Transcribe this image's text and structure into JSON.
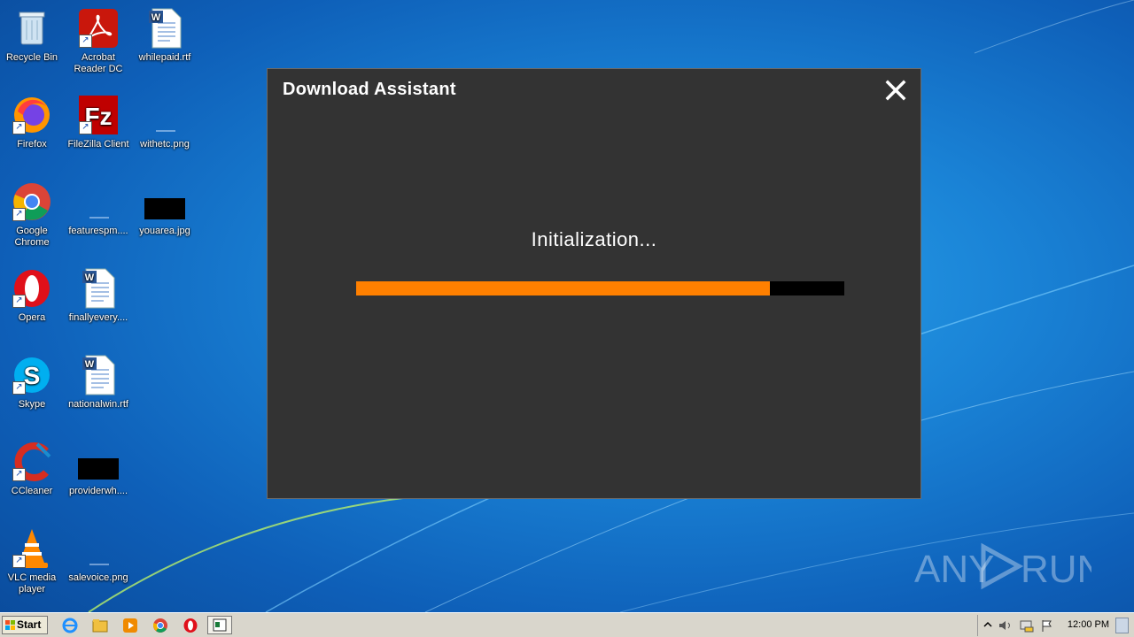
{
  "desktop": {
    "icons": [
      {
        "label": "Recycle Bin",
        "icon": "recycle-bin-icon"
      },
      {
        "label": "Acrobat Reader DC",
        "icon": "acrobat-icon"
      },
      {
        "label": "whilepaid.rtf",
        "icon": "word-document-icon"
      },
      {
        "label": "Firefox",
        "icon": "firefox-icon"
      },
      {
        "label": "FileZilla Client",
        "icon": "filezilla-icon"
      },
      {
        "label": "withetc.png",
        "icon": "image-file-icon"
      },
      {
        "label": "Google Chrome",
        "icon": "chrome-icon"
      },
      {
        "label": "featurespm....",
        "icon": "image-file-icon"
      },
      {
        "label": "youarea.jpg",
        "icon": "image-file-icon"
      },
      {
        "label": "Opera",
        "icon": "opera-icon"
      },
      {
        "label": "finallyevery....",
        "icon": "word-document-icon"
      },
      {
        "label": "Skype",
        "icon": "skype-icon"
      },
      {
        "label": "nationalwin.rtf",
        "icon": "word-document-icon"
      },
      {
        "label": "CCleaner",
        "icon": "ccleaner-icon"
      },
      {
        "label": "providerwh....",
        "icon": "image-file-icon"
      },
      {
        "label": "VLC media player",
        "icon": "vlc-icon"
      },
      {
        "label": "salevoice.png",
        "icon": "image-file-icon"
      }
    ]
  },
  "dialog": {
    "title": "Download Assistant",
    "status": "Initialization...",
    "progress": 0.848,
    "colors": {
      "background": "#333333",
      "progress_fill": "#ff8000",
      "progress_track": "#000000"
    }
  },
  "watermark": {
    "text_left": "ANY",
    "text_right": "RUN"
  },
  "taskbar": {
    "start_label": "Start",
    "pinned": [
      "ie-icon",
      "explorer-icon",
      "media-player-icon",
      "chrome-icon",
      "opera-icon",
      "app-window-icon"
    ],
    "clock": "12:00 PM"
  }
}
